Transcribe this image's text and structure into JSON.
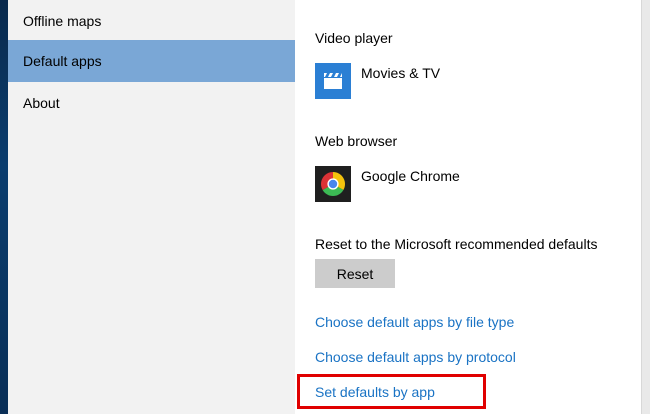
{
  "sidebar": {
    "items": [
      {
        "label": "Offline maps",
        "selected": false
      },
      {
        "label": "Default apps",
        "selected": true
      },
      {
        "label": "About",
        "selected": false
      }
    ]
  },
  "content": {
    "video_player": {
      "heading": "Video player",
      "app_name": "Movies & TV",
      "icon": "clapperboard-icon",
      "tile_color": "#2b7fd4"
    },
    "web_browser": {
      "heading": "Web browser",
      "app_name": "Google Chrome",
      "icon": "chrome-icon",
      "tile_color": "#1f1f1f"
    },
    "reset": {
      "heading": "Reset to the Microsoft recommended defaults",
      "button_label": "Reset"
    },
    "links": {
      "by_file_type": "Choose default apps by file type",
      "by_protocol": "Choose default apps by protocol",
      "by_app": "Set defaults by app"
    }
  },
  "colors": {
    "selected_nav": "#7aa7d6",
    "link": "#1a73c4",
    "highlight": "#e00000"
  }
}
